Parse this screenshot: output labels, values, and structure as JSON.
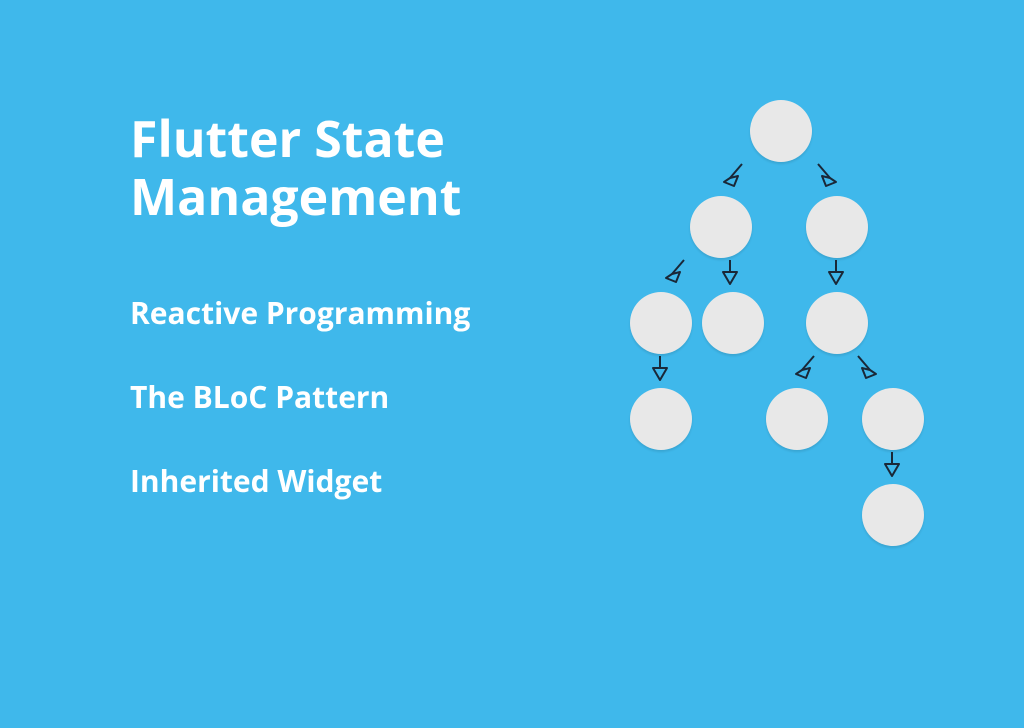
{
  "title_line1": "Flutter State",
  "title_line2": "Management",
  "subtitle1": "Reactive Programming",
  "subtitle2": "The BLoC Pattern",
  "subtitle3": "Inherited Widget",
  "colors": {
    "background": "#3FB8EB",
    "node_fill": "#E8E8E8",
    "text": "#FFFFFF",
    "arrow_stroke": "#1A2838"
  },
  "tree": {
    "description": "Widget tree with circular nodes connected by downward outlined arrows",
    "levels": 5,
    "nodes": [
      {
        "id": "root",
        "level": 0
      },
      {
        "id": "L1a",
        "level": 1
      },
      {
        "id": "L1b",
        "level": 1
      },
      {
        "id": "L2a",
        "level": 2
      },
      {
        "id": "L2b",
        "level": 2
      },
      {
        "id": "L2c",
        "level": 2
      },
      {
        "id": "L3a",
        "level": 3
      },
      {
        "id": "L3b",
        "level": 3
      },
      {
        "id": "L3c",
        "level": 3
      },
      {
        "id": "L4a",
        "level": 4
      }
    ],
    "edges": [
      [
        "root",
        "L1a"
      ],
      [
        "root",
        "L1b"
      ],
      [
        "L1a",
        "L2a"
      ],
      [
        "L1a",
        "L2b"
      ],
      [
        "L1b",
        "L2c"
      ],
      [
        "L2a",
        "L3a"
      ],
      [
        "L2c",
        "L3b"
      ],
      [
        "L2c",
        "L3c"
      ],
      [
        "L3c",
        "L4a"
      ]
    ]
  }
}
